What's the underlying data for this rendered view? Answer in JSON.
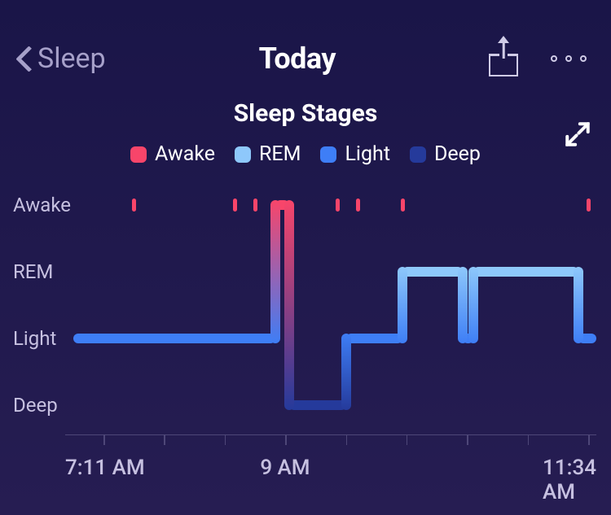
{
  "nav": {
    "back_label": "Sleep",
    "title": "Today"
  },
  "section_title": "Sleep Stages",
  "legend": {
    "awake": "Awake",
    "rem": "REM",
    "light": "Light",
    "deep": "Deep"
  },
  "colors": {
    "awake": "#f8456a",
    "rem": "#8ec8fb",
    "light": "#3e7ef6",
    "deep": "#253a9b"
  },
  "ylabels": {
    "awake": "Awake",
    "rem": "REM",
    "light": "Light",
    "deep": "Deep"
  },
  "xaxis": {
    "start": "7:11 AM",
    "mid": "9 AM",
    "end": "11:34 AM"
  },
  "chart_data": {
    "type": "sleep-hypnogram",
    "time_range": [
      "7:11 AM",
      "11:34 AM"
    ],
    "stages": [
      "Awake",
      "REM",
      "Light",
      "Deep"
    ],
    "segments": [
      {
        "stage": "Light",
        "start": "7:15 AM",
        "end": "8:55 AM"
      },
      {
        "stage": "Awake",
        "start": "8:55 AM",
        "end": "9:02 AM"
      },
      {
        "stage": "Deep",
        "start": "9:02 AM",
        "end": "9:30 AM"
      },
      {
        "stage": "Light",
        "start": "9:30 AM",
        "end": "9:58 AM"
      },
      {
        "stage": "REM",
        "start": "9:58 AM",
        "end": "10:28 AM"
      },
      {
        "stage": "Light",
        "start": "10:28 AM",
        "end": "10:33 AM"
      },
      {
        "stage": "REM",
        "start": "10:33 AM",
        "end": "11:25 AM"
      },
      {
        "stage": "Light",
        "start": "11:25 AM",
        "end": "11:34 AM"
      }
    ],
    "awake_events": [
      "7:44 AM",
      "8:34 AM",
      "8:44 AM",
      "9:25 AM",
      "9:35 AM",
      "9:57 AM",
      "11:29 AM"
    ],
    "legend_colors": {
      "Awake": "#f8456a",
      "REM": "#8ec8fb",
      "Light": "#3e7ef6",
      "Deep": "#253a9b"
    }
  }
}
